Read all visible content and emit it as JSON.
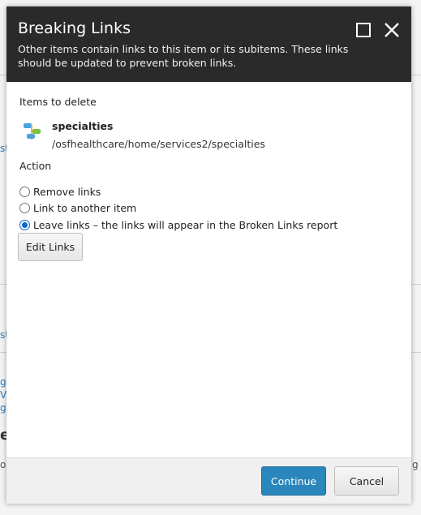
{
  "dialog": {
    "title": "Breaking Links",
    "subtitle": "Other items contain links to this item or its subitems. These links should be updated to prevent broken links.",
    "items_label": "Items to delete",
    "item": {
      "name": "specialties",
      "path": "/osfhealthcare/home/services2/specialties",
      "icon": "item-template-icon"
    },
    "action_label": "Action",
    "options": [
      {
        "label": "Remove links",
        "checked": false
      },
      {
        "label": "Link to another item",
        "checked": false
      },
      {
        "label": "Leave links – the links will appear in the Broken Links report",
        "checked": true
      }
    ],
    "edit_links_label": "Edit Links",
    "continue_label": "Continue",
    "cancel_label": "Cancel"
  },
  "colors": {
    "header_bg": "#2a2a2a",
    "primary_button": "#2a86bb",
    "radio_checked": "#0a65c9"
  }
}
